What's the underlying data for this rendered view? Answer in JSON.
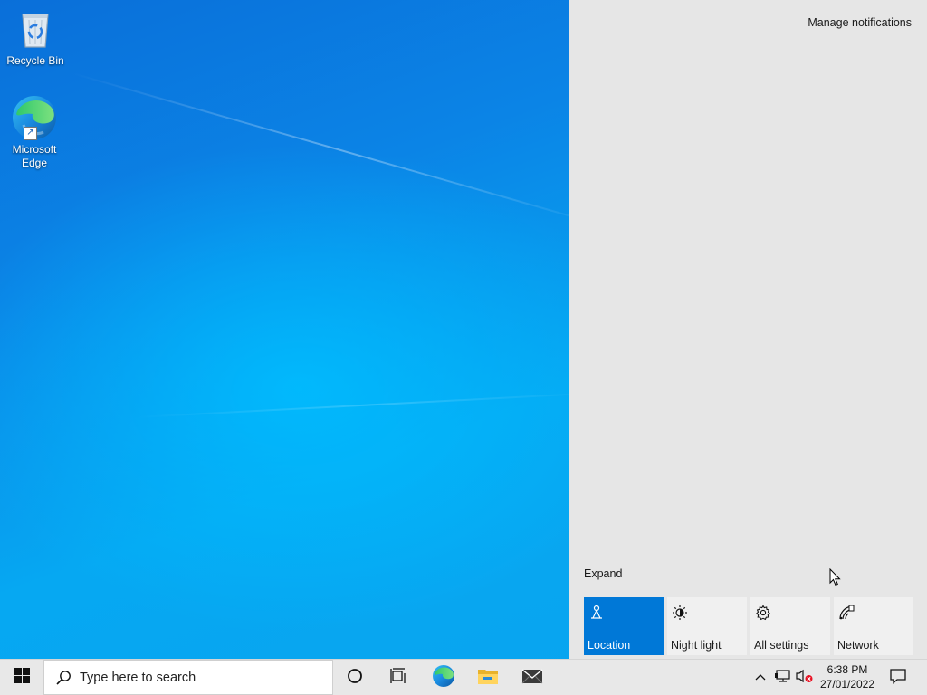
{
  "desktop": {
    "icons": [
      {
        "label": "Recycle Bin",
        "icon": "recycle-bin-icon"
      },
      {
        "label": "Microsoft Edge",
        "icon": "edge-icon"
      }
    ]
  },
  "action_center": {
    "manage_notifications": "Manage notifications",
    "expand": "Expand",
    "quick_actions": [
      {
        "label": "Location",
        "icon": "location-icon",
        "active": true
      },
      {
        "label": "Night light",
        "icon": "night-light-icon",
        "active": false
      },
      {
        "label": "All settings",
        "icon": "gear-icon",
        "active": false
      },
      {
        "label": "Network",
        "icon": "network-icon",
        "active": false
      }
    ]
  },
  "taskbar": {
    "search_placeholder": "Type here to search",
    "pinned": [
      {
        "icon": "cortana-icon"
      },
      {
        "icon": "task-view-icon"
      },
      {
        "icon": "edge-icon"
      },
      {
        "icon": "file-explorer-icon"
      },
      {
        "icon": "mail-icon"
      }
    ],
    "clock": {
      "time": "6:38 PM",
      "date": "27/01/2022"
    }
  },
  "colors": {
    "accent": "#0078d7",
    "action_center_bg": "#e6e6e6",
    "taskbar_bg": "#e8e8e8"
  }
}
